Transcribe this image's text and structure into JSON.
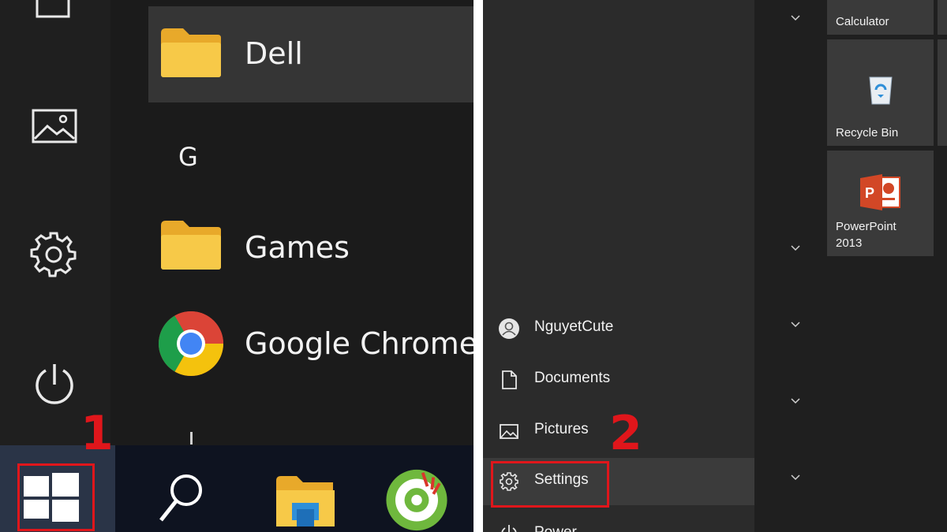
{
  "left_panel": {
    "apps": [
      {
        "label": "Dell",
        "icon": "folder-icon"
      },
      {
        "label": "Games",
        "icon": "folder-icon"
      },
      {
        "label": "Google Chrome",
        "icon": "chrome-icon"
      }
    ],
    "section_letter": "G",
    "rail_icons": [
      "document-icon",
      "pictures-icon",
      "gear-icon",
      "power-icon"
    ],
    "taskbar_icons": [
      "windows-start-icon",
      "search-icon",
      "file-explorer-icon",
      "coc-coc-browser-icon"
    ],
    "step_number": "1"
  },
  "right_panel": {
    "menu": [
      {
        "label": "NguyetCute",
        "icon": "user-avatar-icon"
      },
      {
        "label": "Documents",
        "icon": "document-icon"
      },
      {
        "label": "Pictures",
        "icon": "pictures-icon"
      },
      {
        "label": "Settings",
        "icon": "gear-icon"
      },
      {
        "label": "Power",
        "icon": "power-icon"
      }
    ],
    "tiles": [
      {
        "label": "Calculator",
        "icon": "calculator-icon"
      },
      {
        "label": "Recycle Bin",
        "icon": "recycle-bin-icon"
      },
      {
        "label": "PowerPoint\n2013",
        "line1": "PowerPoint",
        "line2": "2013",
        "icon": "powerpoint-icon"
      }
    ],
    "step_number": "2"
  },
  "colors": {
    "highlight_red": "#e0161b",
    "folder_yellow": "#f7c948",
    "background_dark": "#1f1f1f"
  }
}
